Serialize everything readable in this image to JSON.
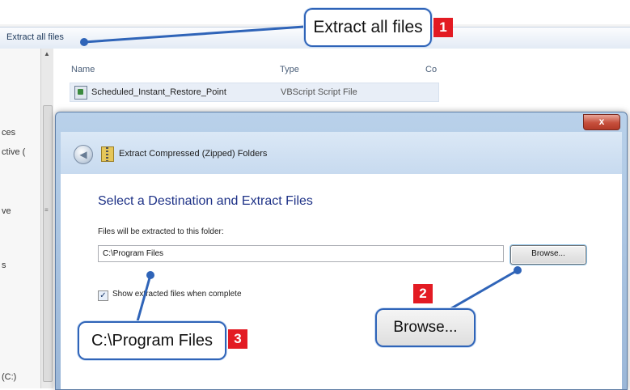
{
  "explorer": {
    "toolbar_label": "Extract all files",
    "nav_fragments": [
      "ces",
      "ctive (",
      "ve",
      "s",
      "(C:)"
    ],
    "columns": {
      "name": "Name",
      "type": "Type",
      "extra": "Co"
    },
    "files": [
      {
        "name": "Scheduled_Instant_Restore_Point",
        "type": "VBScript Script File",
        "icon": "script-file-icon"
      }
    ]
  },
  "dialog": {
    "close_label": "x",
    "title": "Extract Compressed (Zipped) Folders",
    "heading": "Select a Destination and Extract Files",
    "folder_label": "Files will be extracted to this folder:",
    "path_value": "C:\\Program Files",
    "browse_label": "Browse...",
    "checkbox_checked": true,
    "checkbox_label": "Show extracted files when complete"
  },
  "callouts": [
    {
      "text": "Extract all files",
      "badge": "1"
    },
    {
      "text": "Browse...",
      "badge": "2"
    },
    {
      "text": "C:\\Program Files",
      "badge": "3"
    }
  ],
  "colors": {
    "accent": "#2f64b8",
    "badge": "#e31b23",
    "heading": "#1e3287"
  }
}
